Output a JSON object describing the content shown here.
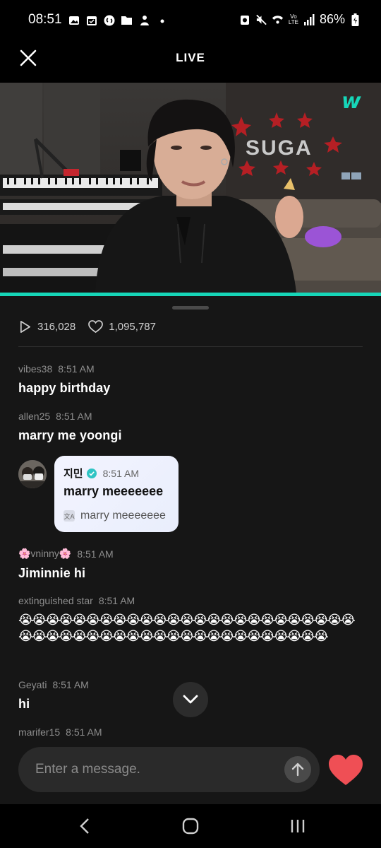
{
  "status_bar": {
    "time": "08:51",
    "battery": "86%",
    "network_label": "Vo LTE"
  },
  "header": {
    "title": "LIVE"
  },
  "video": {
    "brand_logo": "w",
    "sign_text": "SUGA",
    "accent_color": "#16d6b8"
  },
  "stats": {
    "plays": "316,028",
    "likes": "1,095,787"
  },
  "chat": {
    "messages": [
      {
        "user": "vibes38",
        "time": "8:51 AM",
        "text": "happy birthday"
      },
      {
        "user": "allen25",
        "time": "8:51 AM",
        "text": "marry me yoongi"
      },
      {
        "user": "🌸vninny🌸",
        "time": "8:51 AM",
        "text": "Jiminnie hi"
      },
      {
        "user": "extinguished star",
        "time": "8:51 AM",
        "text": "😭😭😭😭😭😭😭😭😭😭😭😭😭😭😭😭😭😭😭😭😭😭😭😭😭😭😭😭😭😭😭😭😭😭😭😭😭😭😭😭😭😭😭😭😭😭😭😭"
      },
      {
        "user": "Geyati",
        "time": "8:51 AM",
        "text": "hi"
      },
      {
        "user": "marifer15",
        "time": "8:51 AM",
        "text": ""
      }
    ],
    "artist_message": {
      "user": "지민",
      "time": "8:51 AM",
      "text": "marry meeeeeee",
      "translation": "marry meeeeeee"
    }
  },
  "composer": {
    "placeholder": "Enter a message."
  },
  "colors": {
    "heart": "#ef4f55",
    "verified": "#2fc4c4"
  }
}
